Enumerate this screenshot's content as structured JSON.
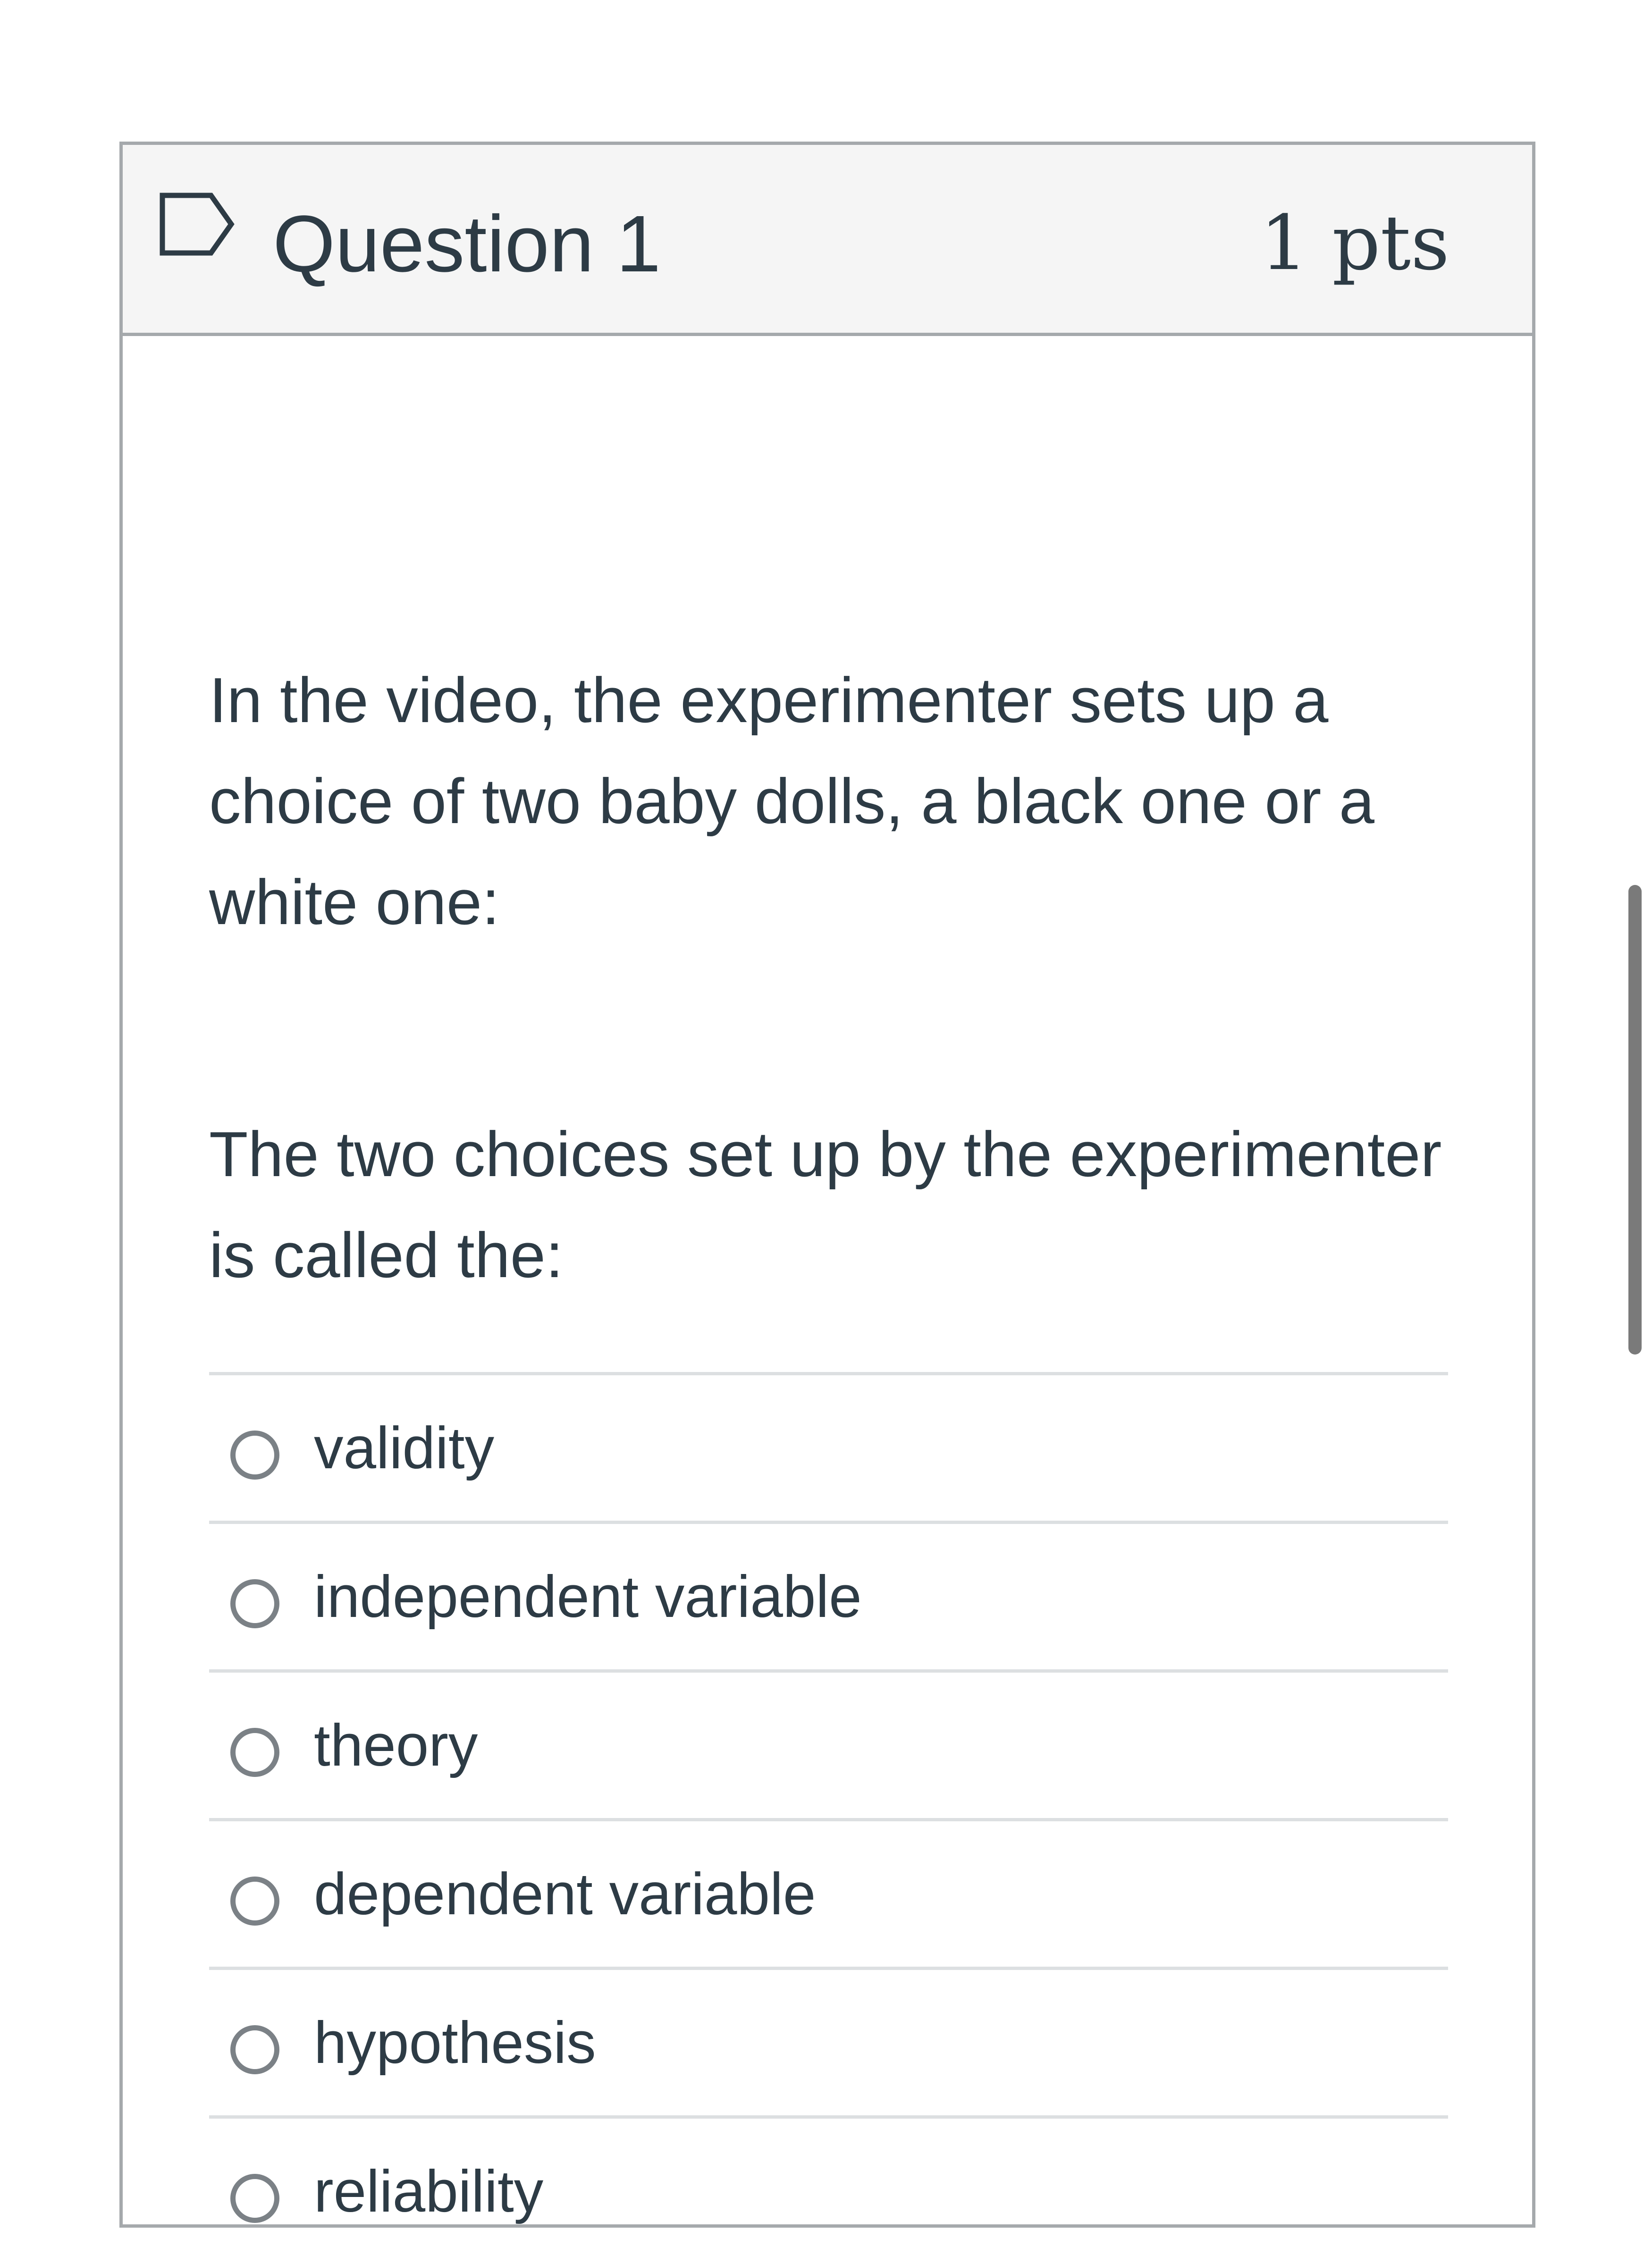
{
  "question": {
    "title": "Question 1",
    "points": "1 pts",
    "flag_icon": "flag-outline-icon",
    "paragraphs": [
      "In the video, the experimenter sets up a choice of two baby dolls, a black one or a white one:",
      "The two choices set up by the experimenter is called the:"
    ]
  },
  "answers": [
    {
      "label": "validity",
      "selected": false
    },
    {
      "label": "independent variable",
      "selected": false
    },
    {
      "label": "theory",
      "selected": false
    },
    {
      "label": "dependent variable",
      "selected": false
    },
    {
      "label": "hypothesis",
      "selected": false
    },
    {
      "label": "reliability",
      "selected": false
    }
  ],
  "colors": {
    "text": "#2d3b45",
    "header_bg": "#f5f5f5",
    "border": "#a5a9ac",
    "divider": "#dcdfe1",
    "radio_border": "#7b8186",
    "scrollbar": "#7a7a7a"
  }
}
